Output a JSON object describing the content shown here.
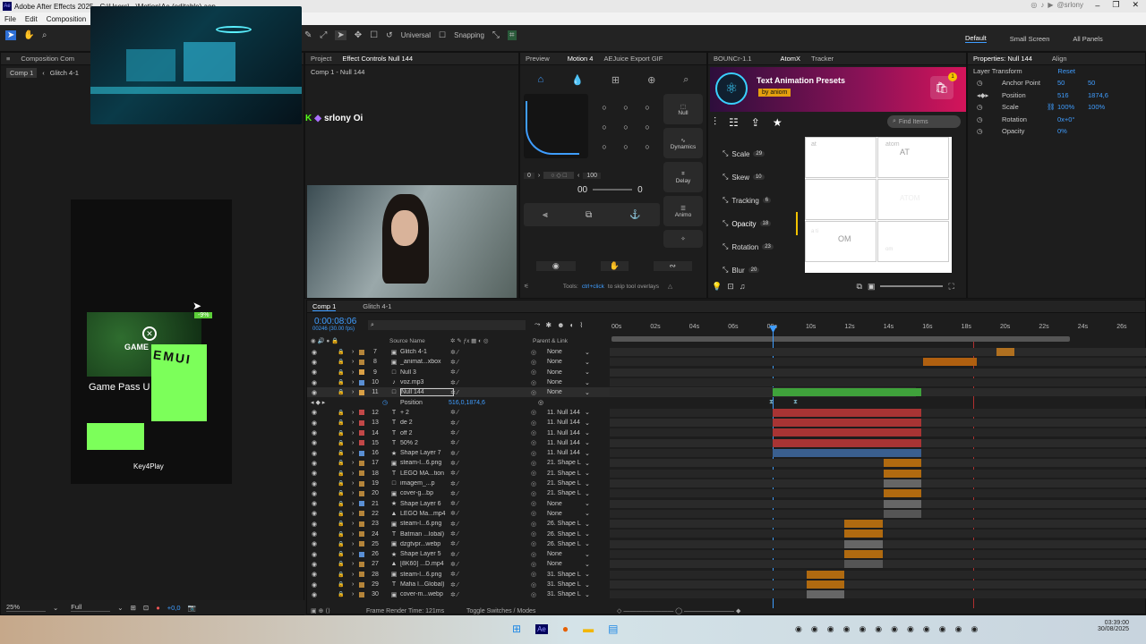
{
  "titlebar": {
    "title": "Adobe After Effects 2025 - C:\\Users\\...\\Motion\\Ae (editable).aep",
    "watermark": "@srlony"
  },
  "menu": [
    "File",
    "Edit",
    "Composition"
  ],
  "toolbar": {
    "universal": "Universal",
    "snapping": "Snapping"
  },
  "workspaces": [
    "Default",
    "Small Screen",
    "All Panels"
  ],
  "left_panel": {
    "tab": "Composition Com",
    "comp_tabs": [
      "Comp 1",
      "Glitch 4-1"
    ],
    "zoom": "25%",
    "quality": "Full",
    "exposure": "+0,0",
    "game_card": {
      "discount": "-9%",
      "title": "GAME",
      "subtitle": "Game Pass U",
      "text_emu": "EMUI",
      "keyplay": "Key4Play"
    }
  },
  "project_panel": {
    "tabs": [
      "Project",
      "Effect Controls Null 144"
    ],
    "breadcrumb": "Comp 1 - Null 144",
    "overlay_text": "srlony Oi"
  },
  "motion_panel": {
    "tabs": [
      "Preview",
      "Motion 4",
      "AEJuice Export GIF"
    ],
    "null_label": "Null",
    "dynamics_label": "Dynamics",
    "delay_label": "Delay",
    "animo_label": "Animo",
    "left_value": "0",
    "right_value": "100",
    "counter_left": "00",
    "counter_right": "0",
    "footer_hint_pre": "Tools: ",
    "footer_hint_key": "ctrl+click",
    "footer_hint_post": " to skip tool overlays"
  },
  "atom_panel": {
    "tabs": [
      "BOUNCr-1.1",
      "AtomX",
      "Tracker"
    ],
    "title": "Text Animation Presets",
    "by_label": "by aniom",
    "badge": "1",
    "search_placeholder": "Find Items",
    "sidebar": [
      {
        "label": "Scale",
        "count": "29"
      },
      {
        "label": "Skew",
        "count": "10"
      },
      {
        "label": "Tracking",
        "count": "6"
      },
      {
        "label": "Opacity",
        "count": "18"
      },
      {
        "label": "Rotation",
        "count": "23"
      },
      {
        "label": "Blur",
        "count": "20"
      }
    ],
    "cells": [
      "at",
      "atom",
      "AT",
      "ATOM",
      "OM",
      "a ti",
      "om"
    ]
  },
  "properties_panel": {
    "tabs": [
      "Properties: Null 144",
      "Align"
    ],
    "section": "Layer Transform",
    "reset": "Reset",
    "rows": [
      {
        "label": "Anchor Point",
        "v1": "50",
        "v2": "50"
      },
      {
        "label": "Position",
        "v1": "516",
        "v2": "1874,6"
      },
      {
        "label": "Scale",
        "v1": "100%",
        "v2": "100%"
      },
      {
        "label": "Rotation",
        "v1": "0x+0°",
        "v2": ""
      },
      {
        "label": "Opacity",
        "v1": "0%",
        "v2": ""
      }
    ]
  },
  "timeline": {
    "tabs": [
      "Comp 1",
      "Glitch 4-1"
    ],
    "timecode": "0:00:08:06",
    "fps": "00246 (30.00 fps)",
    "search_placeholder": "",
    "col_source": "Source Name",
    "col_parent": "Parent & Link",
    "ticks": [
      "00s",
      "02s",
      "04s",
      "06s",
      "08s",
      "10s",
      "12s",
      "14s",
      "16s",
      "18s",
      "20s",
      "22s",
      "24s",
      "26s"
    ],
    "position_value": "516,0,1874,6",
    "position_label": "Position",
    "footer_render": "Frame Render Time: 121ms",
    "footer_toggle": "Toggle Switches / Modes",
    "layers": [
      {
        "num": "7",
        "type": "img",
        "name": "Glitch 4-1",
        "parent": "None",
        "color": "#b5853a"
      },
      {
        "num": "8",
        "type": "img",
        "name": "_animat...xbox",
        "parent": "None",
        "color": "#b5853a"
      },
      {
        "num": "9",
        "type": "box",
        "name": "Null 3",
        "parent": "None",
        "color": "#d9a046"
      },
      {
        "num": "10",
        "type": "aud",
        "name": "voz.mp3",
        "parent": "None",
        "color": "#5a8fd4"
      },
      {
        "num": "11",
        "type": "box",
        "name": "Null 144",
        "parent": "None",
        "color": "#d9a046"
      },
      {
        "num": "12",
        "type": "T",
        "name": "+ 2",
        "parent": "11. Null 144",
        "color": "#c24848"
      },
      {
        "num": "13",
        "type": "T",
        "name": "de 2",
        "parent": "11. Null 144",
        "color": "#c24848"
      },
      {
        "num": "14",
        "type": "T",
        "name": "off 2",
        "parent": "11. Null 144",
        "color": "#c24848"
      },
      {
        "num": "15",
        "type": "T",
        "name": "50% 2",
        "parent": "11. Null 144",
        "color": "#c24848"
      },
      {
        "num": "16",
        "type": "★",
        "name": "Shape Layer 7",
        "parent": "11. Null 144",
        "color": "#5a8fd4"
      },
      {
        "num": "17",
        "type": "img",
        "name": "steam-l...6.png",
        "parent": "21. Shape L",
        "color": "#b5853a"
      },
      {
        "num": "18",
        "type": "T",
        "name": "LEGO MA...tion",
        "parent": "21. Shape L",
        "color": "#b5853a"
      },
      {
        "num": "19",
        "type": "box",
        "name": "imagem_...p",
        "parent": "21. Shape L",
        "color": "#b5853a"
      },
      {
        "num": "20",
        "type": "img",
        "name": "cover-g...bp",
        "parent": "21. Shape L",
        "color": "#b5853a"
      },
      {
        "num": "21",
        "type": "★",
        "name": "Shape Layer 6",
        "parent": "None",
        "color": "#5a8fd4"
      },
      {
        "num": "22",
        "type": "vid",
        "name": "LEGO Ma...mp4",
        "parent": "None",
        "color": "#b5853a"
      },
      {
        "num": "23",
        "type": "img",
        "name": "steam-l...6.png",
        "parent": "26. Shape L",
        "color": "#b5853a"
      },
      {
        "num": "24",
        "type": "T",
        "name": "Batman ...lobal)",
        "parent": "26. Shape L",
        "color": "#b5853a"
      },
      {
        "num": "25",
        "type": "img",
        "name": "dzgtvpr...webp",
        "parent": "26. Shape L",
        "color": "#b5853a"
      },
      {
        "num": "26",
        "type": "★",
        "name": "Shape Layer 5",
        "parent": "None",
        "color": "#5a8fd4"
      },
      {
        "num": "27",
        "type": "vid",
        "name": "[8K60] ...D.mp4",
        "parent": "None",
        "color": "#b5853a"
      },
      {
        "num": "28",
        "type": "img",
        "name": "steam-l...6.png",
        "parent": "31. Shape L",
        "color": "#b5853a"
      },
      {
        "num": "29",
        "type": "T",
        "name": "Mafia I...Global)",
        "parent": "31. Shape L",
        "color": "#b5853a"
      },
      {
        "num": "30",
        "type": "img",
        "name": "cover-m...webp",
        "parent": "31. Shape L",
        "color": "#b5853a"
      }
    ]
  },
  "taskbar": {
    "time": "03:39:00",
    "date": "30/08/2025"
  },
  "colors": {
    "accent": "#3f9dff",
    "null_green": "#3fa23b",
    "text_red": "#c23a3a",
    "shape_blue": "#3a5f8f",
    "media_orange": "#c27a1f",
    "game_green": "#7cff5a"
  }
}
